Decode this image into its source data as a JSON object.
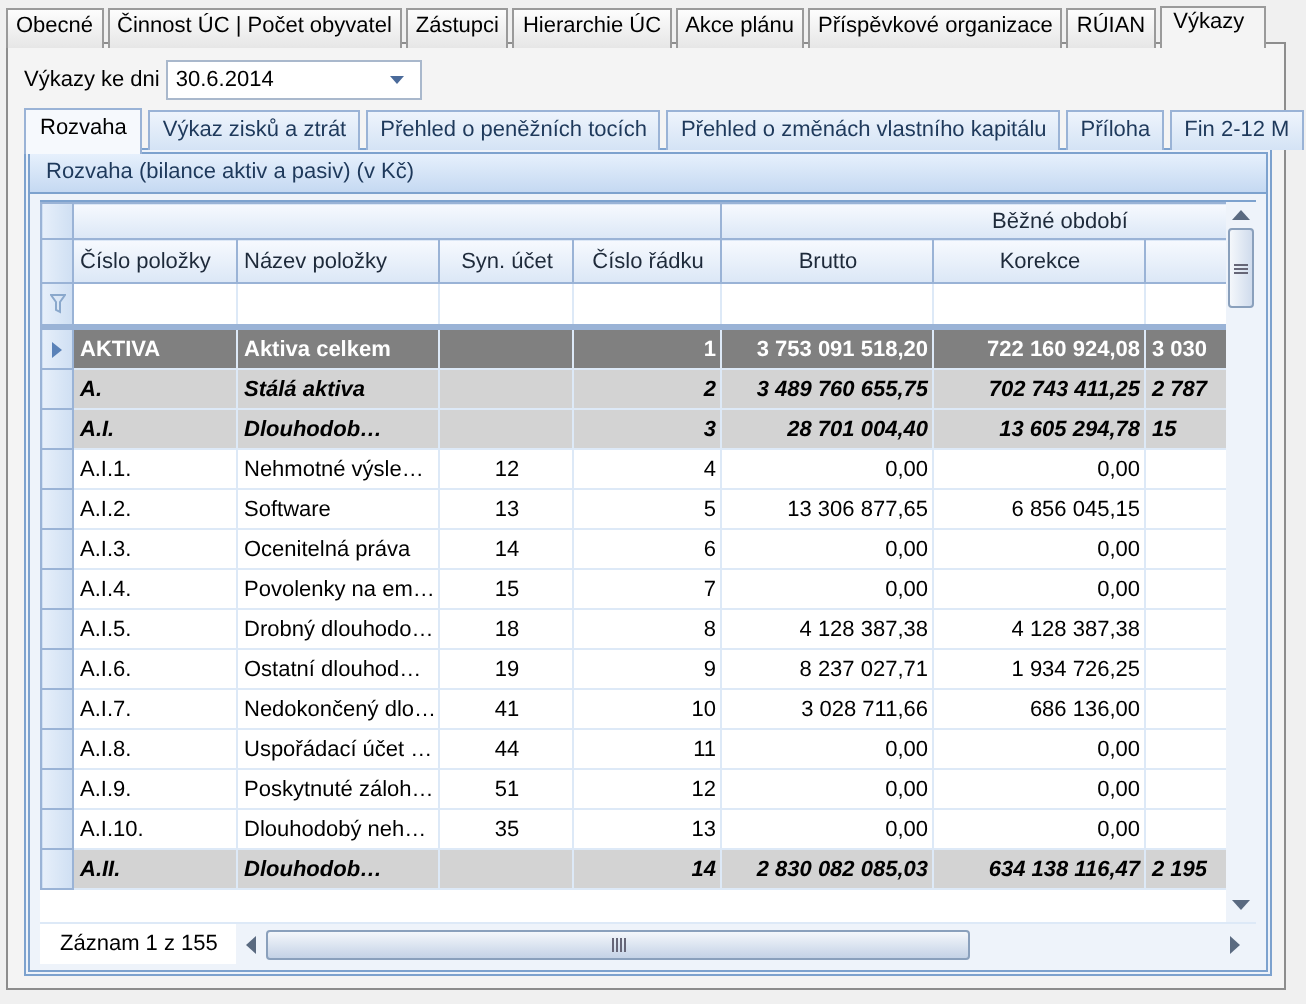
{
  "top_tabs": [
    {
      "label": "Obecné",
      "selected": false
    },
    {
      "label": "Činnost ÚC | Počet obyvatel",
      "selected": false
    },
    {
      "label": "Zástupci",
      "selected": false
    },
    {
      "label": "Hierarchie ÚC",
      "selected": false
    },
    {
      "label": "Akce plánu",
      "selected": false
    },
    {
      "label": "Příspěvkové organizace",
      "selected": false
    },
    {
      "label": "RÚIAN",
      "selected": false
    },
    {
      "label": "Výkazy",
      "selected": true
    }
  ],
  "date_field": {
    "label": "Výkazy ke dni",
    "value": "30.6.2014"
  },
  "report_tabs": [
    {
      "label": "Rozvaha",
      "selected": true
    },
    {
      "label": "Výkaz zisků a ztrát",
      "selected": false
    },
    {
      "label": "Přehled o peněžních tocích",
      "selected": false
    },
    {
      "label": "Přehled o změnách vlastního kapitálu",
      "selected": false
    },
    {
      "label": "Příloha",
      "selected": false
    },
    {
      "label": "Fin 2-12 M",
      "selected": false
    }
  ],
  "panel_title": "Rozvaha (bilance aktiv a pasiv) (v Kč)",
  "grid": {
    "band": "Běžné období",
    "columns": [
      "Číslo položky",
      "Název položky",
      "Syn. účet",
      "Číslo řádku",
      "Brutto",
      "Korekce"
    ],
    "rows": [
      {
        "kind": "total",
        "selected": true,
        "code": "AKTIVA",
        "name": "Aktiva celkem",
        "account": "",
        "line": "1",
        "brutto": "3 753 091 518,20",
        "korekce": "722 160 924,08",
        "column_3": "3 030"
      },
      {
        "kind": "group",
        "selected": false,
        "code": "A.",
        "name": "Stálá aktiva",
        "account": "",
        "line": "2",
        "brutto": "3 489 760 655,75",
        "korekce": "702 743 411,25",
        "column_3": "2 787"
      },
      {
        "kind": "group",
        "selected": false,
        "code": "A.I.",
        "name": "Dlouhodob…",
        "account": "",
        "line": "3",
        "brutto": "28 701 004,40",
        "korekce": "13 605 294,78",
        "column_3": "15"
      },
      {
        "kind": "item",
        "selected": false,
        "code": "A.I.1.",
        "name": "Nehmotné výsle…",
        "account": "12",
        "line": "4",
        "brutto": "0,00",
        "korekce": "0,00"
      },
      {
        "kind": "item",
        "selected": false,
        "code": "A.I.2.",
        "name": "Software",
        "account": "13",
        "line": "5",
        "brutto": "13 306 877,65",
        "korekce": "6 856 045,15"
      },
      {
        "kind": "item",
        "selected": false,
        "code": "A.I.3.",
        "name": "Ocenitelná práva",
        "account": "14",
        "line": "6",
        "brutto": "0,00",
        "korekce": "0,00"
      },
      {
        "kind": "item",
        "selected": false,
        "code": "A.I.4.",
        "name": "Povolenky na em…",
        "account": "15",
        "line": "7",
        "brutto": "0,00",
        "korekce": "0,00"
      },
      {
        "kind": "item",
        "selected": false,
        "code": "A.I.5.",
        "name": "Drobný dlouhodo…",
        "account": "18",
        "line": "8",
        "brutto": "4 128 387,38",
        "korekce": "4 128 387,38"
      },
      {
        "kind": "item",
        "selected": false,
        "code": "A.I.6.",
        "name": "Ostatní dlouhod…",
        "account": "19",
        "line": "9",
        "brutto": "8 237 027,71",
        "korekce": "1 934 726,25"
      },
      {
        "kind": "item",
        "selected": false,
        "code": "A.I.7.",
        "name": "Nedokončený dlo…",
        "account": "41",
        "line": "10",
        "brutto": "3 028 711,66",
        "korekce": "686 136,00"
      },
      {
        "kind": "item",
        "selected": false,
        "code": "A.I.8.",
        "name": "Uspořádací účet …",
        "account": "44",
        "line": "11",
        "brutto": "0,00",
        "korekce": "0,00"
      },
      {
        "kind": "item",
        "selected": false,
        "code": "A.I.9.",
        "name": "Poskytnuté záloh…",
        "account": "51",
        "line": "12",
        "brutto": "0,00",
        "korekce": "0,00"
      },
      {
        "kind": "item",
        "selected": false,
        "code": "A.I.10.",
        "name": "Dlouhodobý neh…",
        "account": "35",
        "line": "13",
        "brutto": "0,00",
        "korekce": "0,00"
      },
      {
        "kind": "group",
        "selected": false,
        "code": "A.II.",
        "name": "Dlouhodob…",
        "account": "",
        "line": "14",
        "brutto": "2 830 082 085,03",
        "korekce": "634 138 116,47",
        "column_3": "2 195"
      }
    ]
  },
  "record_counter": "Záznam 1 z 155"
}
